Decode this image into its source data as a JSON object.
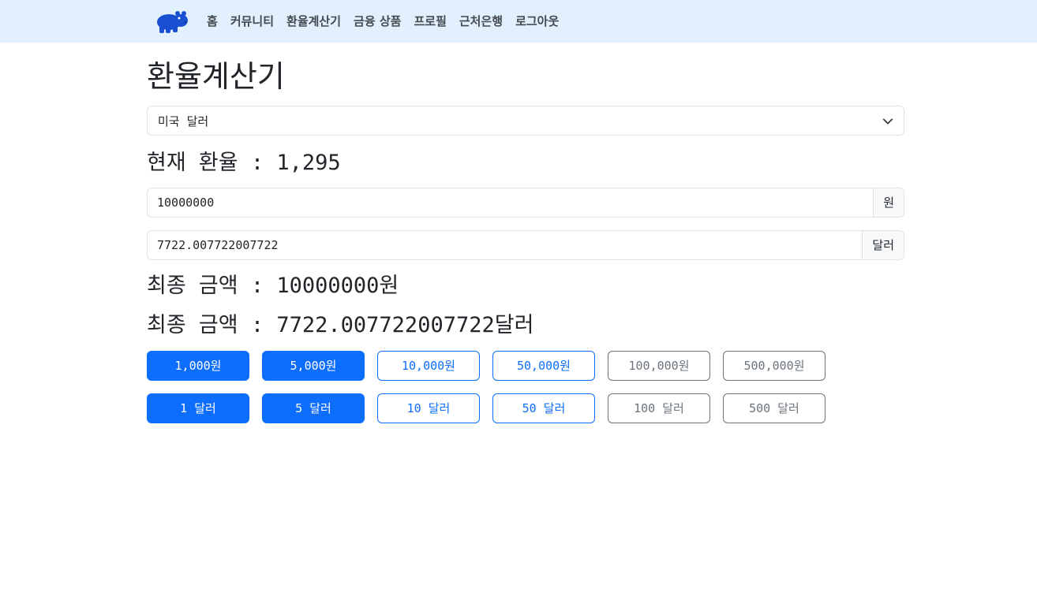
{
  "nav": {
    "logo_icon": "hippo-logo-icon",
    "items": [
      "홈",
      "커뮤니티",
      "환율계산기",
      "금융 상품",
      "프로필",
      "근처은행",
      "로그아웃"
    ]
  },
  "page": {
    "title": "환율계산기"
  },
  "currency_select": {
    "selected": "미국 달러",
    "icon": "chevron-down-icon"
  },
  "rate": {
    "label": "현재 환율 : 1,295"
  },
  "won_input": {
    "value": "10000000",
    "unit": "원"
  },
  "dollar_input": {
    "value": "7722.007722007722",
    "unit": "달러"
  },
  "final": {
    "won": "최종 금액 : 10000000원",
    "dollar": "최종 금액 : 7722.007722007722달러"
  },
  "won_buttons": [
    "1,000원",
    "5,000원",
    "10,000원",
    "50,000원",
    "100,000원",
    "500,000원"
  ],
  "dollar_buttons": [
    "1 달러",
    "5 달러",
    "10 달러",
    "50 달러",
    "100 달러",
    "500 달러"
  ],
  "colors": {
    "primary": "#0d6efd",
    "secondary": "#6c757d",
    "navbar_bg": "#e1f0fc",
    "logo": "#1b4fd1"
  }
}
